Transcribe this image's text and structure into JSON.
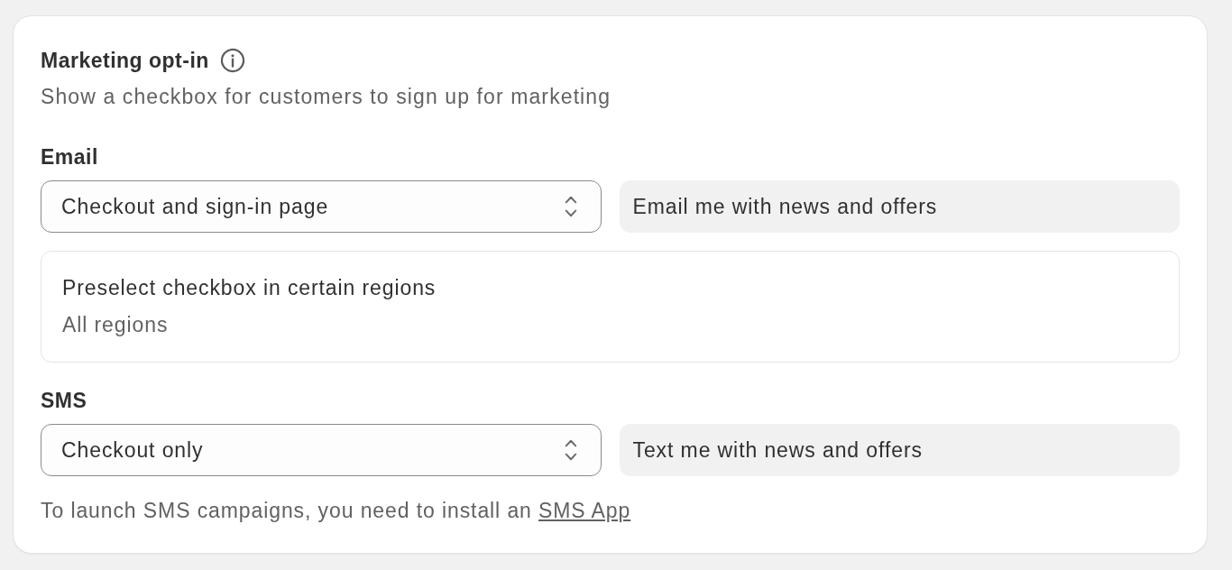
{
  "card": {
    "title": "Marketing opt-in",
    "description": "Show a checkbox for customers to sign up for marketing"
  },
  "sections": [
    {
      "label": "Email",
      "select": {
        "value": "Checkout and sign-in page"
      },
      "checkbox_label_field": {
        "value": "Email me with news and offers"
      },
      "preselect": {
        "title": "Preselect checkbox in certain regions",
        "value": "All regions"
      }
    },
    {
      "label": "SMS",
      "select": {
        "value": "Checkout only"
      },
      "checkbox_label_field": {
        "value": "Text me with news and offers"
      }
    }
  ],
  "footer": {
    "text": "To launch SMS campaigns, you need to install an ",
    "link": "SMS App"
  }
}
